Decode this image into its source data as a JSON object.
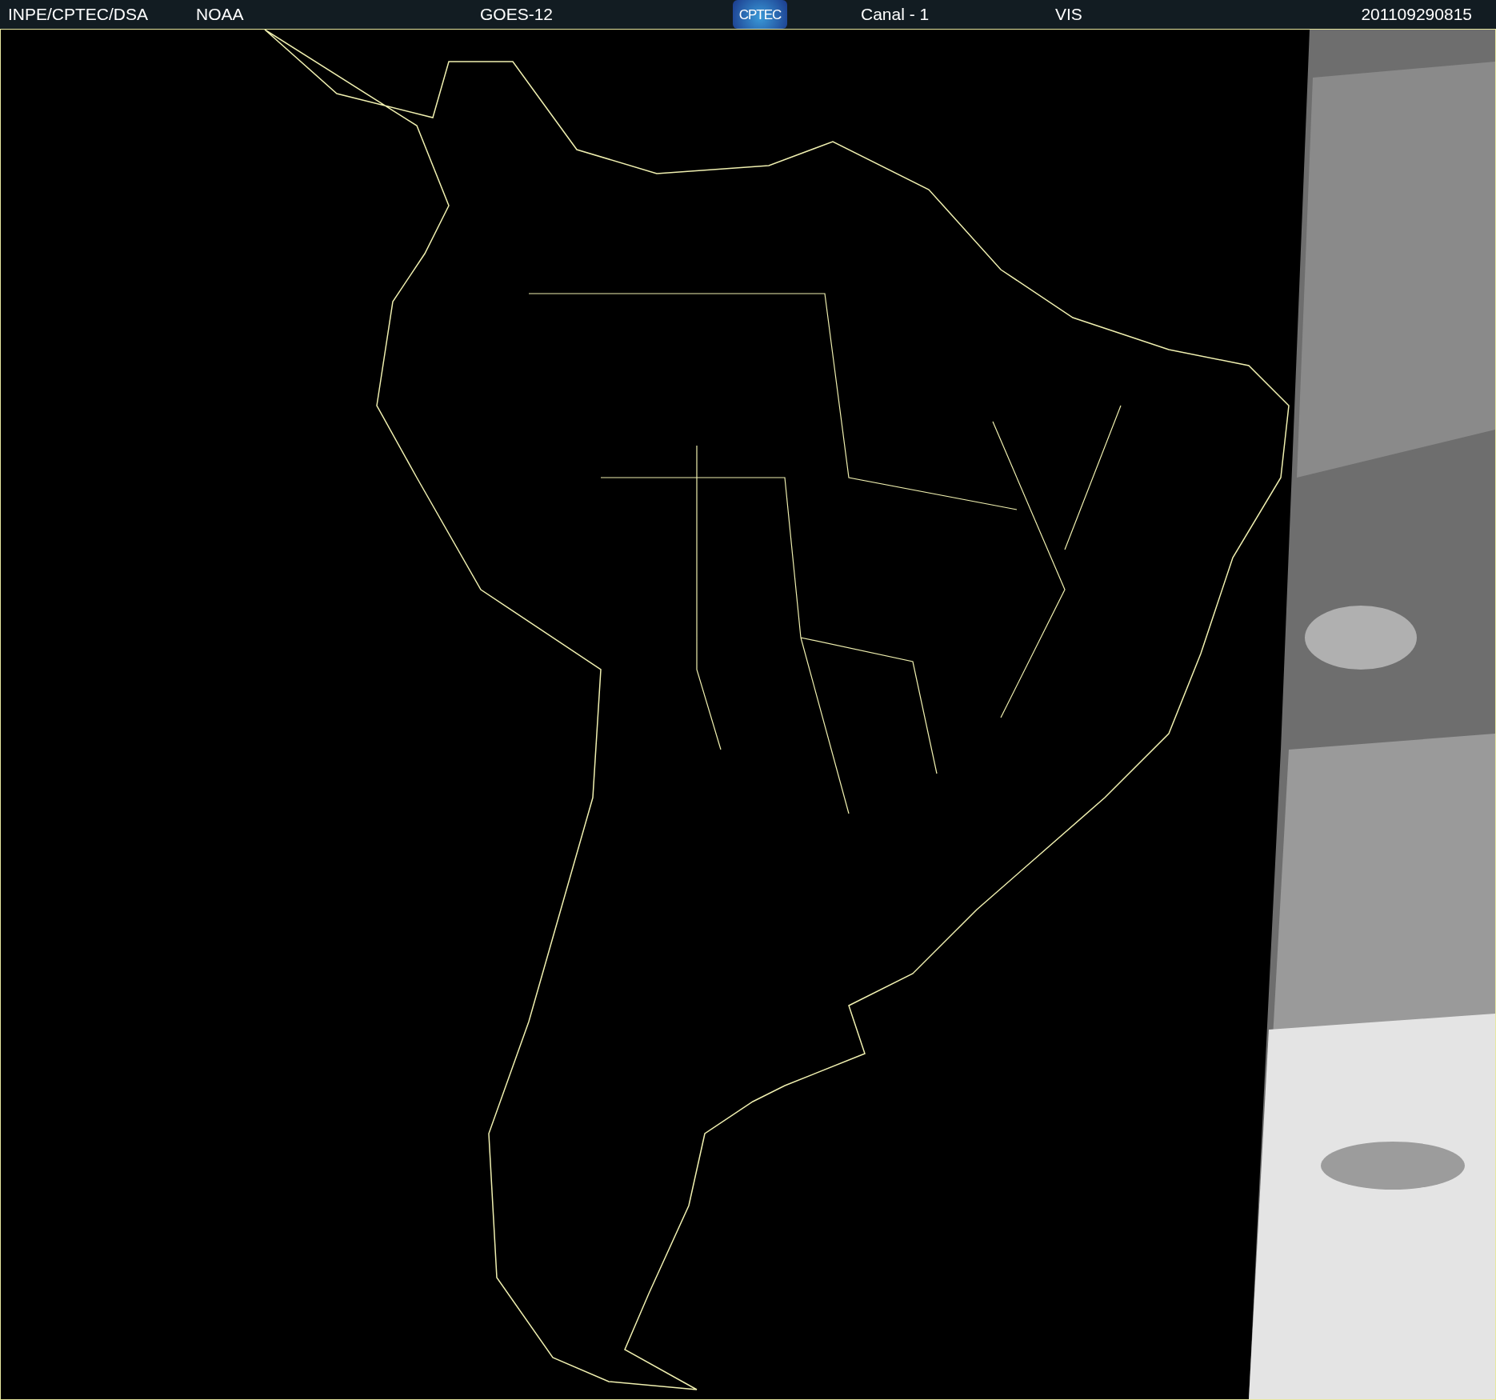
{
  "header": {
    "source": "INPE/CPTEC/DSA",
    "agency": "NOAA",
    "satellite": "GOES-12",
    "logo": "CPTEC",
    "channel": "Canal - 1",
    "band": "VIS",
    "timestamp": "201109290815"
  }
}
